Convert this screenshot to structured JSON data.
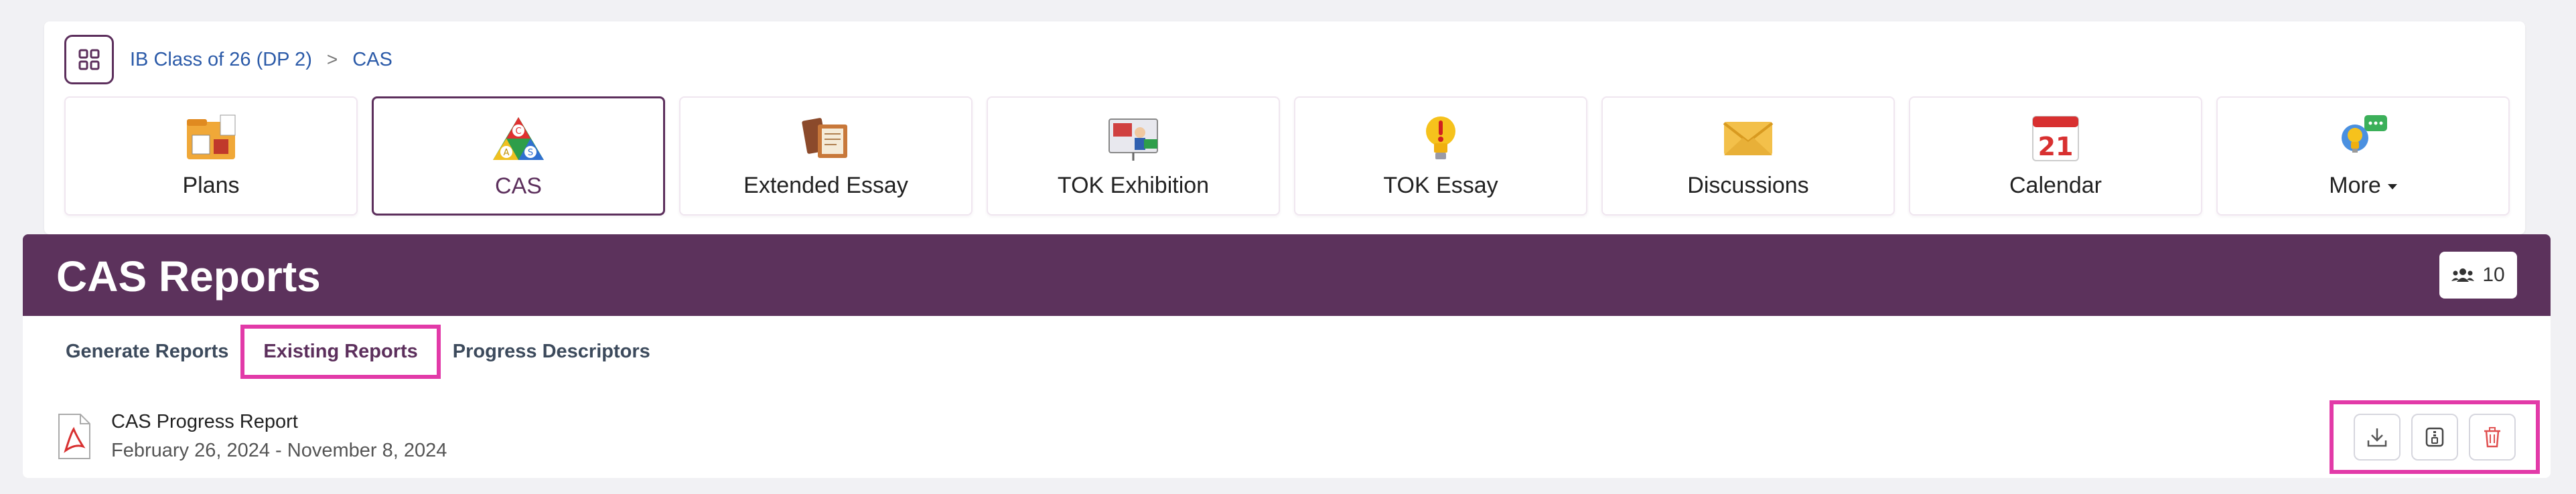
{
  "breadcrumb": {
    "class_name": "IB Class of 26 (DP 2)",
    "separator": ">",
    "current": "CAS"
  },
  "tiles": [
    {
      "label": "Plans",
      "icon": "plans-folder-icon"
    },
    {
      "label": "CAS",
      "icon": "cas-triangle-icon",
      "active": true
    },
    {
      "label": "Extended Essay",
      "icon": "books-icon"
    },
    {
      "label": "TOK Exhibition",
      "icon": "exhibition-screen-icon"
    },
    {
      "label": "TOK Essay",
      "icon": "lightbulb-icon"
    },
    {
      "label": "Discussions",
      "icon": "envelope-icon"
    },
    {
      "label": "Calendar",
      "icon": "calendar-icon",
      "day": "21"
    },
    {
      "label": "More",
      "icon": "more-icon"
    }
  ],
  "header": {
    "title": "CAS Reports",
    "member_count": "10"
  },
  "tabs": {
    "generate": "Generate Reports",
    "existing": "Existing Reports",
    "descriptors": "Progress Descriptors"
  },
  "report": {
    "title": "CAS Progress Report",
    "date_range": "February 26, 2024 - November 8, 2024"
  },
  "colors": {
    "brand": "#5c325c",
    "link": "#2b5aa8",
    "highlight": "#e23aa8",
    "danger": "#e05050"
  }
}
